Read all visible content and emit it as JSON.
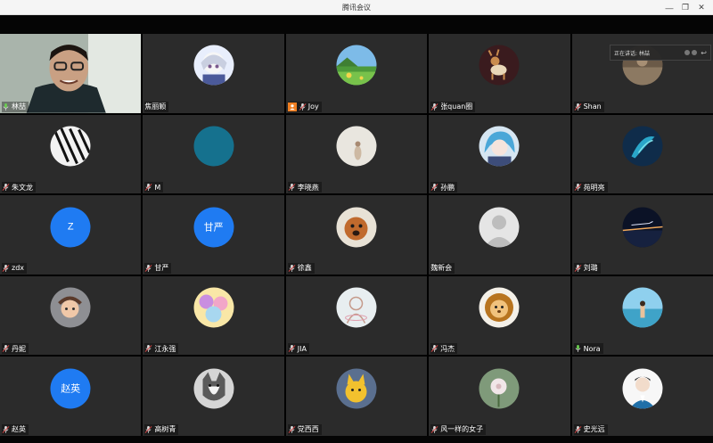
{
  "window": {
    "title": "腾讯会议",
    "buttons": [
      "—",
      "❐",
      "✕"
    ]
  },
  "speaking_indicator": {
    "label": "正在讲话: 林喆"
  },
  "colors": {
    "tile_bg": "#2b2b2b",
    "blue_avatar": "#1f7bf2",
    "active_border": "#6ad04f"
  },
  "participants": [
    {
      "name": "林喆",
      "avatar": "camera",
      "mic": "active"
    },
    {
      "name": "焦丽颖",
      "avatar": "anime-girl",
      "mic": "none"
    },
    {
      "name": "Joy",
      "avatar": "landscape",
      "mic": "muted",
      "badge": "host"
    },
    {
      "name": "张quan圈",
      "avatar": "deer",
      "mic": "muted"
    },
    {
      "name": "Shan",
      "avatar": "photo",
      "mic": "muted"
    },
    {
      "name": "朱文龙",
      "avatar": "sketch",
      "mic": "muted"
    },
    {
      "name": "M",
      "avatar": "teal",
      "mic": "muted"
    },
    {
      "name": "李晓燕",
      "avatar": "light-photo",
      "mic": "muted"
    },
    {
      "name": "孙鹏",
      "avatar": "blue-hair-girl",
      "mic": "muted"
    },
    {
      "name": "苑明亮",
      "avatar": "bird",
      "mic": "muted"
    },
    {
      "name": "zdx",
      "avatar": "letter",
      "avatar_text": "Z",
      "mic": "muted"
    },
    {
      "name": "甘严",
      "avatar": "letter",
      "avatar_text": "甘严",
      "mic": "muted"
    },
    {
      "name": "徐鑫",
      "avatar": "dog",
      "mic": "muted"
    },
    {
      "name": "魏新会",
      "avatar": "default",
      "mic": "none"
    },
    {
      "name": "刘璐",
      "avatar": "dark-sky",
      "mic": "muted"
    },
    {
      "name": "丹妮",
      "avatar": "cartoon",
      "mic": "muted"
    },
    {
      "name": "江永强",
      "avatar": "colorful",
      "mic": "muted"
    },
    {
      "name": "JIA",
      "avatar": "sketch-light",
      "mic": "muted"
    },
    {
      "name": "冯杰",
      "avatar": "lion",
      "mic": "muted"
    },
    {
      "name": "Nora",
      "avatar": "sea",
      "mic": "active"
    },
    {
      "name": "赵英",
      "avatar": "letter",
      "avatar_text": "赵英",
      "mic": "muted"
    },
    {
      "name": "高树青",
      "avatar": "husky",
      "mic": "muted"
    },
    {
      "name": "党西西",
      "avatar": "yellow-cartoon",
      "mic": "muted"
    },
    {
      "name": "风一样的女子",
      "avatar": "flower",
      "mic": "muted"
    },
    {
      "name": "史光远",
      "avatar": "man-illustration",
      "mic": "muted"
    }
  ]
}
